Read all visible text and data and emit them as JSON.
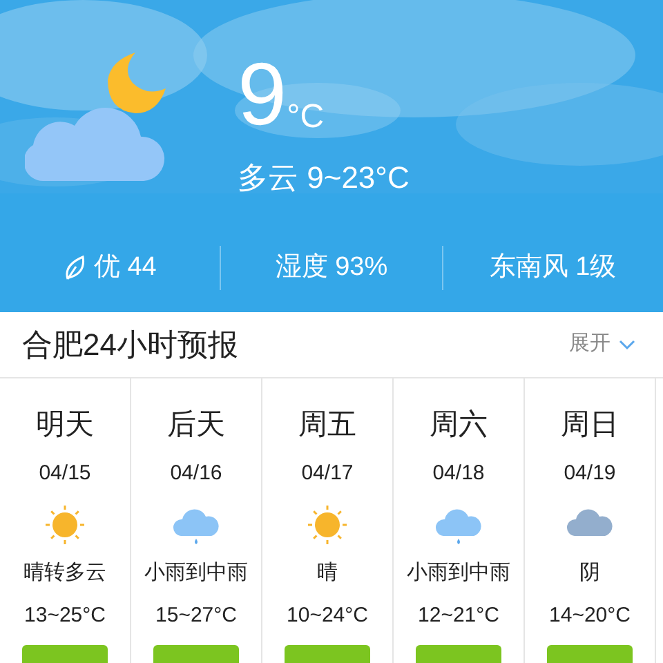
{
  "current": {
    "temperature": "9",
    "unit": "°C",
    "summary": "多云 9~23°C",
    "kind": "cloudy-night"
  },
  "stats": [
    {
      "kind": "air",
      "text": "优 44"
    },
    {
      "kind": "plain",
      "text": "湿度 93%"
    },
    {
      "kind": "plain",
      "text": "东南风 1级"
    }
  ],
  "forecast_header": {
    "title": "合肥24小时预报",
    "toggle": "展开"
  },
  "days": [
    {
      "day": "明天",
      "date": "04/15",
      "kind": "sunny",
      "condition": "晴转多云",
      "range": "13~25°C"
    },
    {
      "day": "后天",
      "date": "04/16",
      "kind": "rain",
      "condition": "小雨到中雨",
      "range": "15~27°C"
    },
    {
      "day": "周五",
      "date": "04/17",
      "kind": "sunny",
      "condition": "晴",
      "range": "10~24°C"
    },
    {
      "day": "周六",
      "date": "04/18",
      "kind": "rain",
      "condition": "小雨到中雨",
      "range": "12~21°C"
    },
    {
      "day": "周日",
      "date": "04/19",
      "kind": "overcast",
      "condition": "阴",
      "range": "14~20°C"
    }
  ]
}
